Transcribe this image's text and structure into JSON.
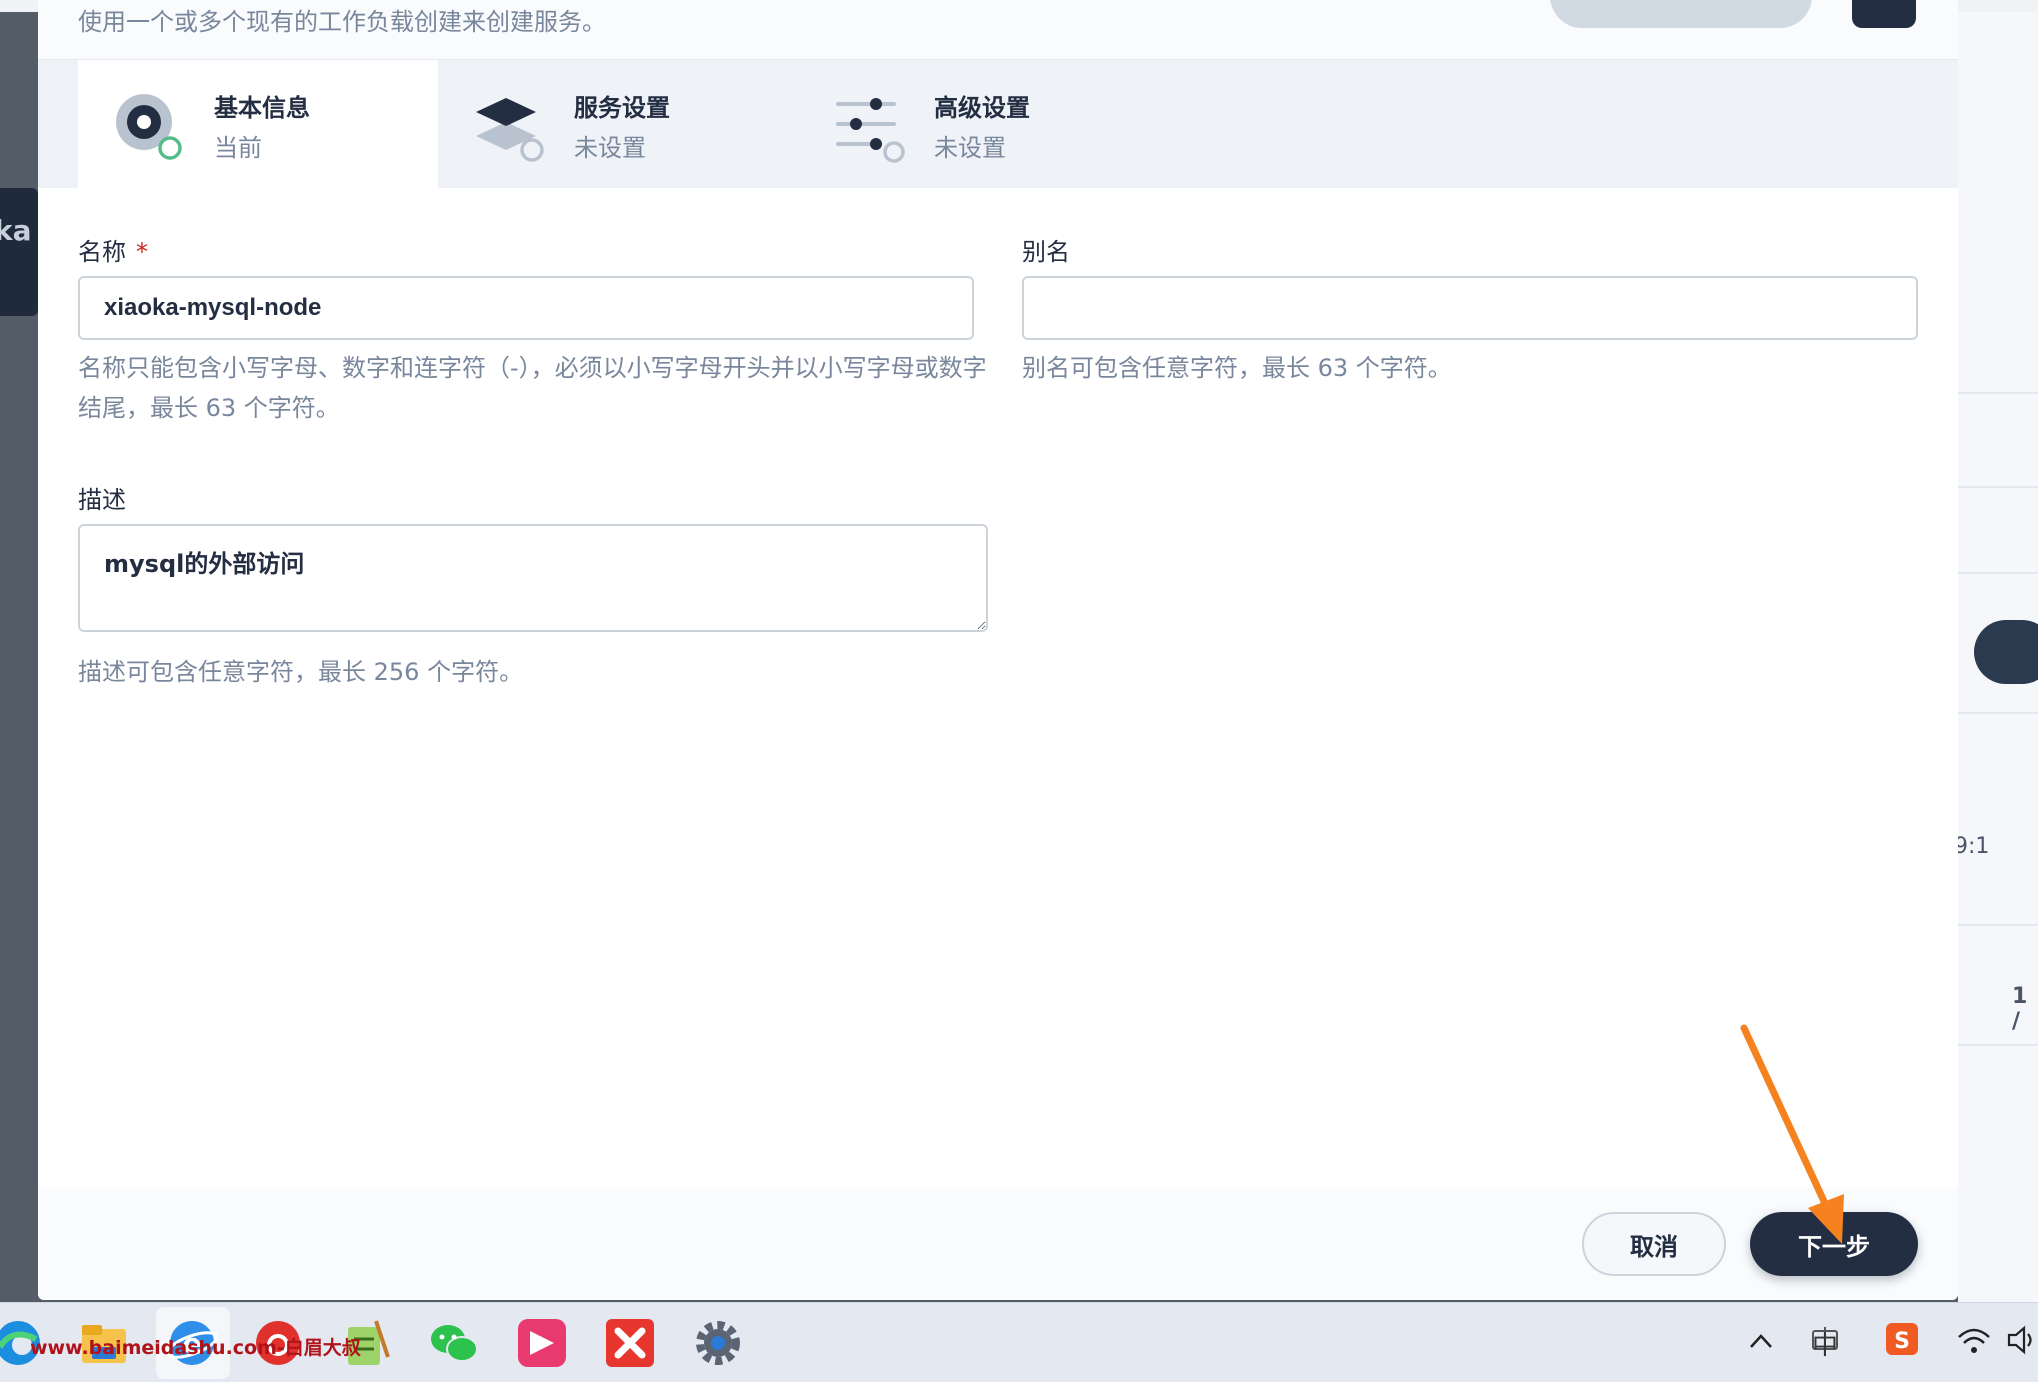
{
  "header": {
    "hint": "使用一个或多个现有的工作负载创建来创建服务。"
  },
  "steps": [
    {
      "title": "基本信息",
      "status": "当前",
      "icon": "basic-info-icon",
      "active": true
    },
    {
      "title": "服务设置",
      "status": "未设置",
      "icon": "service-settings-icon",
      "active": false
    },
    {
      "title": "高级设置",
      "status": "未设置",
      "icon": "advanced-settings-icon",
      "active": false
    }
  ],
  "form": {
    "name": {
      "label": "名称",
      "required_mark": "*",
      "value": "xiaoka-mysql-node",
      "help": "名称只能包含小写字母、数字和连字符（-），必须以小写字母开头并以小写字母或数字结尾，最长 63 个字符。"
    },
    "alias": {
      "label": "别名",
      "value": "",
      "help": "别名可包含任意字符，最长 63 个字符。"
    },
    "description": {
      "label": "描述",
      "value": "mysql的外部访问",
      "help": "描述可包含任意字符，最长 256 个字符。"
    }
  },
  "footer": {
    "cancel_label": "取消",
    "next_label": "下一步"
  },
  "background": {
    "left_tab_fragment": "ka",
    "right_fragment_1": "9:1",
    "right_fragment_2": "1 /"
  },
  "taskbar": {
    "watermark": "www.baimeidashu.com-白眉大叔",
    "apps": [
      "edge-icon",
      "file-explorer-icon",
      "browser-icon",
      "netease-music-icon",
      "notepad-icon",
      "wechat-icon",
      "kingsoft-app-icon",
      "xmind-icon",
      "settings-gear-icon"
    ],
    "tray": {
      "ime_label": "中",
      "icons": [
        "chevron-up-icon",
        "keyboard-icon",
        "sogou-input-icon",
        "wifi-icon",
        "speaker-icon"
      ]
    }
  },
  "colors": {
    "primary": "#242e42",
    "muted_text": "#79879c",
    "required": "#ca2621",
    "success_ring": "#55bc8a",
    "annotation_arrow": "#f5821f"
  }
}
